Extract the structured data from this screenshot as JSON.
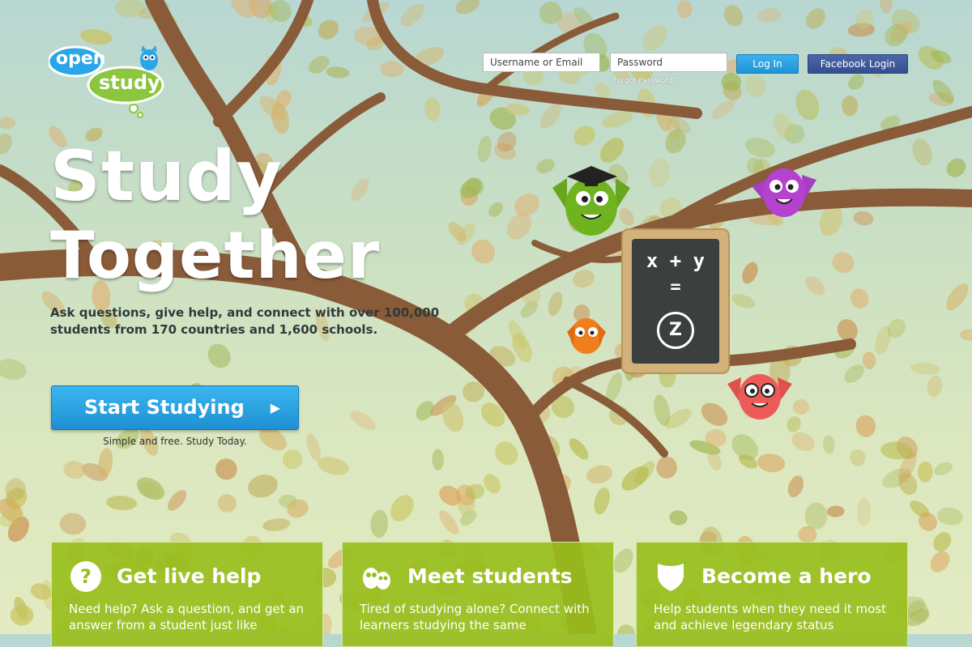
{
  "logo": {
    "line1": "open",
    "line2": "study"
  },
  "login": {
    "username_placeholder": "Username or Email",
    "password_placeholder": "Password",
    "login_label": "Log In",
    "facebook_label": "Facebook Login",
    "forgot_label": "Forgot Password?"
  },
  "hero": {
    "title_line1": "Study",
    "title_line2": "Together",
    "description": "Ask questions, give help, and connect with over 100,000 students from 170 countries and 1,600 schools.",
    "cta_label": "Start Studying",
    "cta_sub": "Simple and free. Study Today."
  },
  "chalkboard": {
    "line1": "x + y",
    "line2": "=",
    "badge": "Z"
  },
  "cards": [
    {
      "icon": "question-icon",
      "title": "Get live help",
      "body": "Need help? Ask a question, and get an answer from a student just like"
    },
    {
      "icon": "owls-icon",
      "title": "Meet students",
      "body": "Tired of studying alone? Connect with learners studying the same"
    },
    {
      "icon": "shield-icon",
      "title": "Become a hero",
      "body": "Help students when they need it most and achieve legendary status"
    }
  ],
  "colors": {
    "brand_blue": "#2aa6e8",
    "brand_green": "#8cc63f",
    "facebook": "#3b5998",
    "card_green": "#98be1c"
  }
}
